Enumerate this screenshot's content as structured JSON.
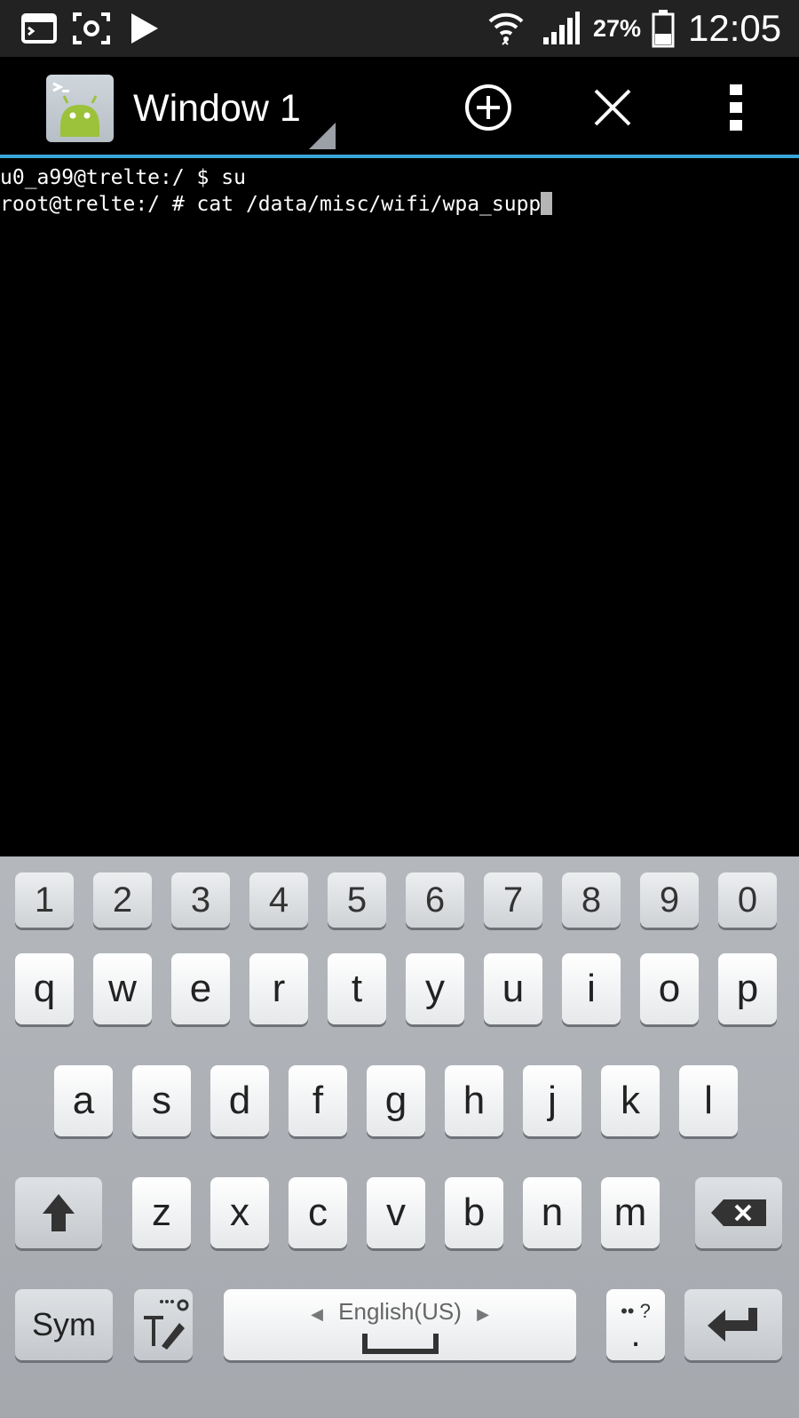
{
  "status_bar": {
    "icons": [
      "terminal-notification-icon",
      "screenshot-icon",
      "play-store-icon",
      "wifi-icon",
      "signal-icon",
      "battery-icon"
    ],
    "battery_percent": "27%",
    "time": "12:05"
  },
  "action_bar": {
    "title": "Window 1",
    "accent_color": "#3aa6d8",
    "buttons": [
      "add-window-icon",
      "close-window-icon",
      "overflow-menu-icon"
    ]
  },
  "terminal": {
    "lines": [
      "u0_a99@trelte:/ $ su",
      "root@trelte:/ # cat /data/misc/wifi/wpa_supp"
    ]
  },
  "keyboard": {
    "number_row": [
      "1",
      "2",
      "3",
      "4",
      "5",
      "6",
      "7",
      "8",
      "9",
      "0"
    ],
    "row1": [
      "q",
      "w",
      "e",
      "r",
      "t",
      "y",
      "u",
      "i",
      "o",
      "p"
    ],
    "row2": [
      "a",
      "s",
      "d",
      "f",
      "g",
      "h",
      "j",
      "k",
      "l"
    ],
    "row3": [
      "z",
      "x",
      "c",
      "v",
      "b",
      "n",
      "m"
    ],
    "sym_label": "Sym",
    "language_label": "English(US)",
    "punct_label": "?"
  }
}
